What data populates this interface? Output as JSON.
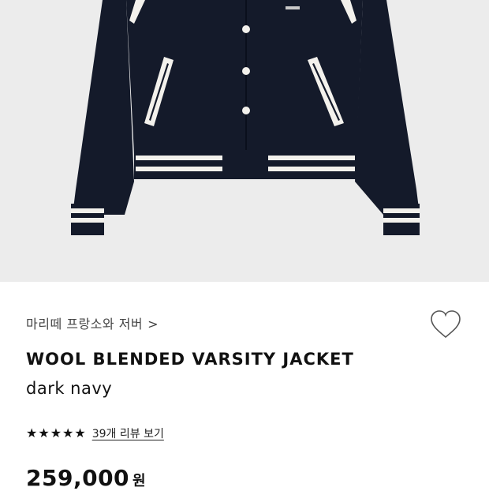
{
  "product_image": {
    "alt": "dark navy varsity jacket"
  },
  "product": {
    "brand": "마리떼 프랑소와 저버",
    "brand_chevron": ">",
    "title": "WOOL BLENDED VARSITY JACKET",
    "color_name": "dark navy",
    "rating": 5,
    "stars": [
      "★",
      "★",
      "★",
      "★",
      "★"
    ],
    "reviews_label": "39개 리뷰 보기",
    "price": "259,000",
    "currency_label": "원"
  },
  "colors": {
    "jacket": "#141a2a",
    "stripe": "#f3f1ec",
    "hero_bg": "#ececec"
  },
  "icons": {
    "wishlist": "heart-outline-icon"
  }
}
